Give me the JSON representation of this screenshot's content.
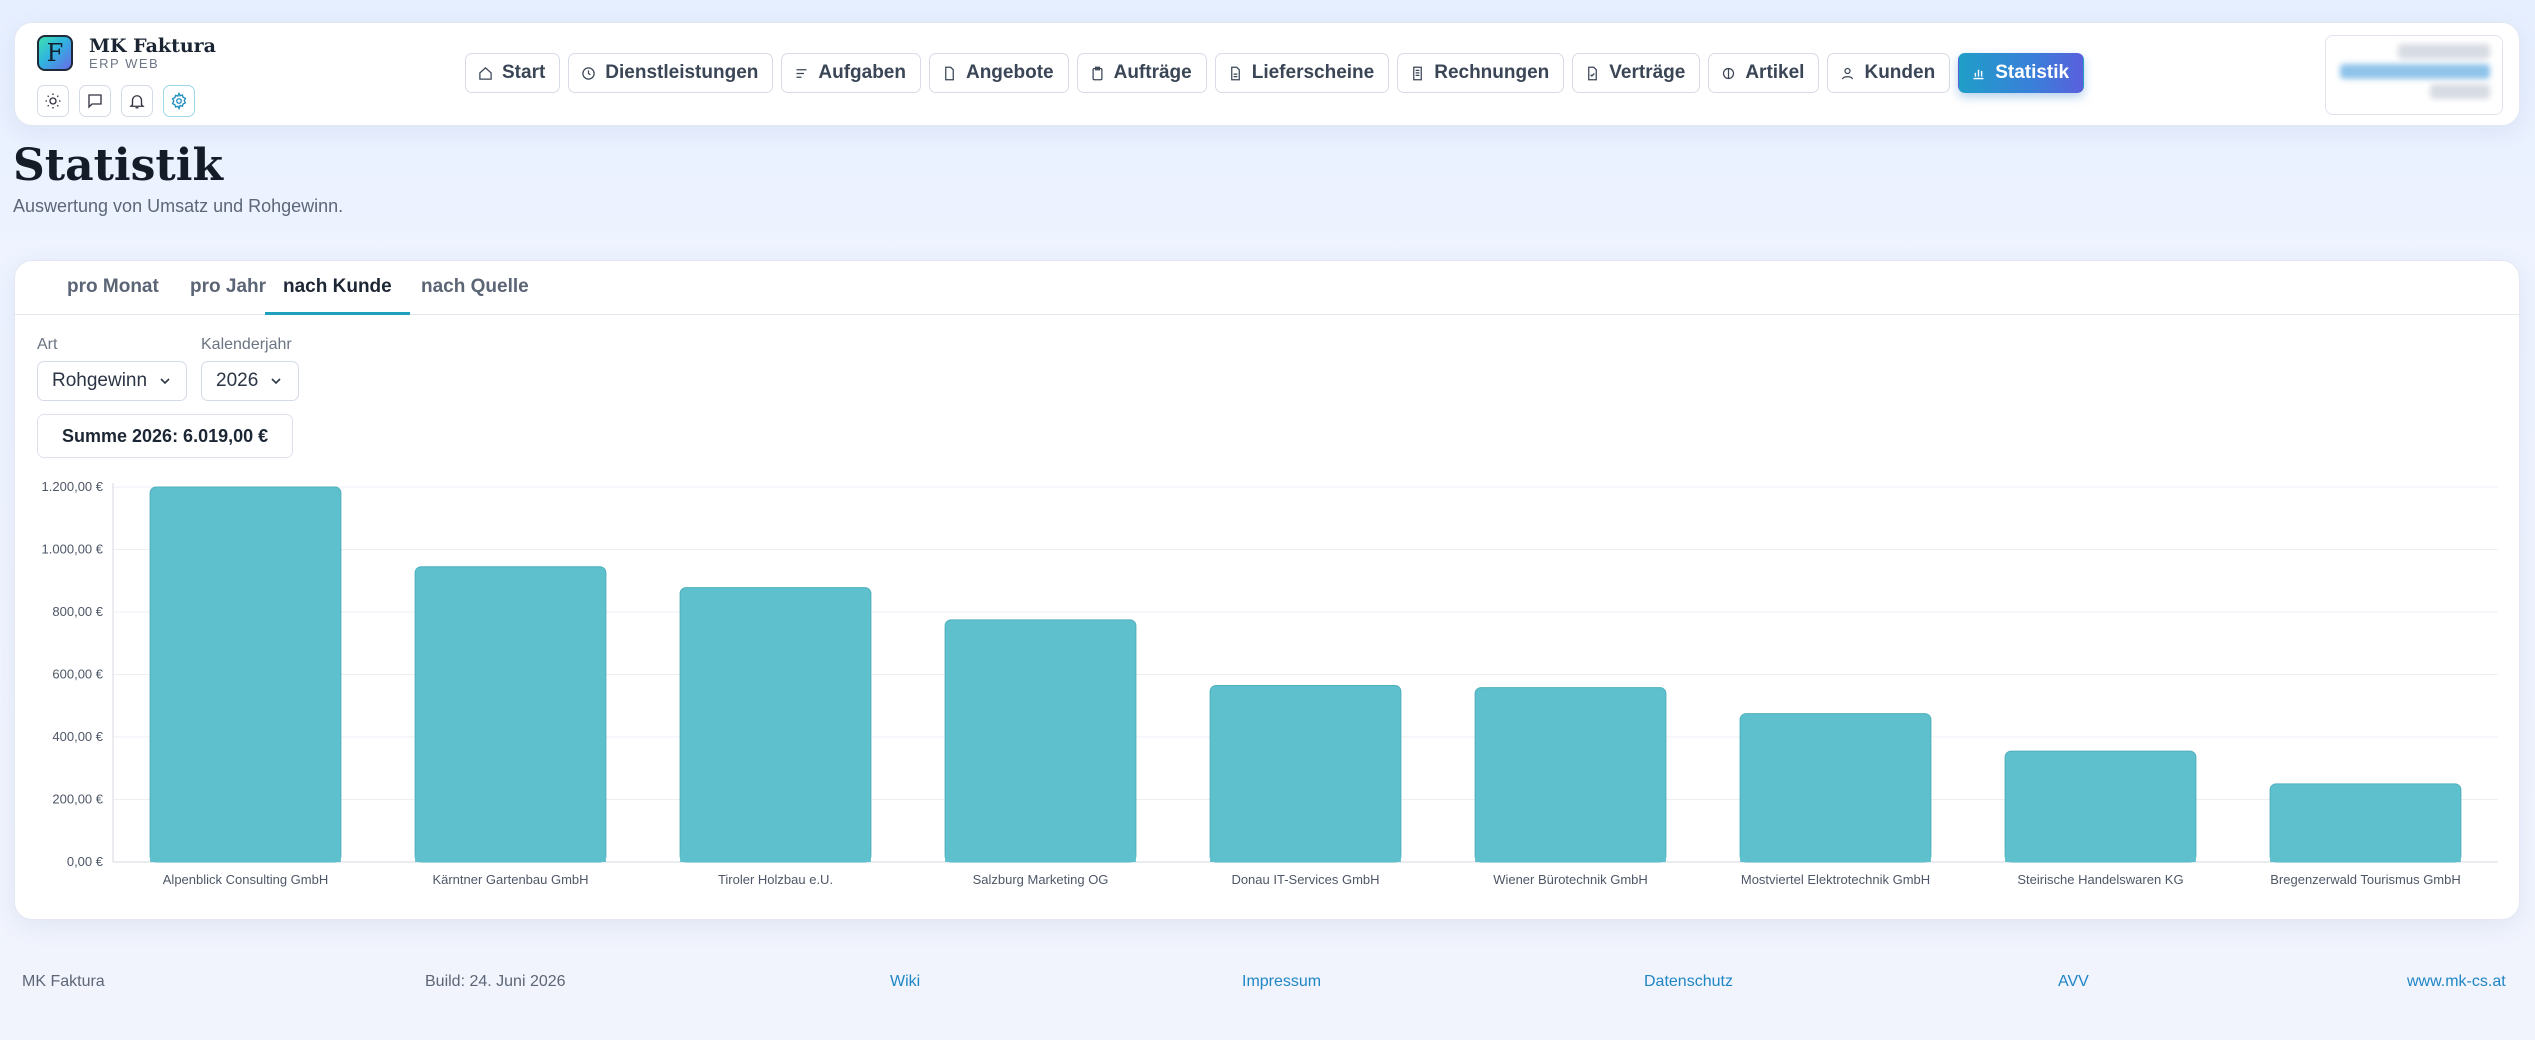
{
  "app": {
    "name": "MK Faktura",
    "subtitle": "ERP WEB",
    "logo_letter": "F"
  },
  "nav": [
    {
      "label": "Start",
      "icon": "home-icon"
    },
    {
      "label": "Dienstleistungen",
      "icon": "clock-icon"
    },
    {
      "label": "Aufgaben",
      "icon": "list-icon"
    },
    {
      "label": "Angebote",
      "icon": "file-icon"
    },
    {
      "label": "Aufträge",
      "icon": "clipboard-icon"
    },
    {
      "label": "Lieferscheine",
      "icon": "document-icon"
    },
    {
      "label": "Rechnungen",
      "icon": "receipt-icon"
    },
    {
      "label": "Verträge",
      "icon": "contract-icon"
    },
    {
      "label": "Artikel",
      "icon": "box-icon"
    },
    {
      "label": "Kunden",
      "icon": "user-icon"
    },
    {
      "label": "Statistik",
      "icon": "bar-chart-icon",
      "active": true
    }
  ],
  "page": {
    "title": "Statistik",
    "subtitle": "Auswertung von Umsatz und Rohgewinn."
  },
  "tabs": [
    {
      "label": "pro Monat"
    },
    {
      "label": "pro Jahr"
    },
    {
      "label": "nach Kunde",
      "active": true
    },
    {
      "label": "nach Quelle"
    }
  ],
  "filters": {
    "art_label": "Art",
    "art_value": "Rohgewinn",
    "year_label": "Kalenderjahr",
    "year_value": "2026"
  },
  "summary": "Summe 2026: 6.019,00 €",
  "chart_data": {
    "type": "bar",
    "categories": [
      "Alpenblick Consulting GmbH",
      "Kärntner Gartenbau GmbH",
      "Tiroler Holzbau e.U.",
      "Salzburg Marketing OG",
      "Donau IT-Services GmbH",
      "Wiener Bürotechnik GmbH",
      "Mostviertel Elektrotechnik GmbH",
      "Steirische Handelswaren KG",
      "Bregenzerwald Tourismus GmbH"
    ],
    "values": [
      1200,
      945,
      878,
      775,
      565,
      558,
      475,
      355,
      250
    ],
    "yticks": [
      "0,00 €",
      "200,00 €",
      "400,00 €",
      "600,00 €",
      "800,00 €",
      "1.000,00 €",
      "1.200,00 €"
    ],
    "ylim": [
      0,
      1200
    ],
    "grid": true,
    "bar_color": "#5ec0cc"
  },
  "footer": {
    "app": "MK Faktura",
    "build": "Build: 24. Juni 2026",
    "wiki": "Wiki",
    "impressum": "Impressum",
    "datenschutz": "Datenschutz",
    "avv": "AVV",
    "website": "www.mk-cs.at"
  }
}
